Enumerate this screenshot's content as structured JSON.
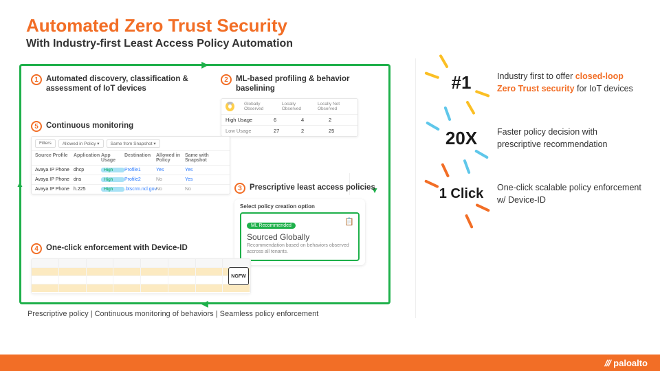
{
  "header": {
    "title": "Automated Zero Trust Security",
    "subtitle": "With Industry-first Least Access Policy Automation"
  },
  "steps": {
    "s1": {
      "num": "1",
      "title": "Automated discovery, classification & assessment of IoT devices"
    },
    "s2": {
      "num": "2",
      "title": "ML-based profiling & behavior baselining"
    },
    "s3": {
      "num": "3",
      "title": "Prescriptive least access policies"
    },
    "s4": {
      "num": "4",
      "title": "One-click enforcement with Device-ID"
    },
    "s5": {
      "num": "5",
      "title": "Continuous monitoring"
    }
  },
  "toolbar": {
    "filters": "Filters",
    "allowed": "Allowed in Policy ▾",
    "same": "Same from Snapshot ▾"
  },
  "table": {
    "headers": [
      "Source Profile",
      "Application",
      "App Usage",
      "Destination",
      "Allowed in Policy",
      "Same with Snapshot"
    ],
    "rows": [
      {
        "src": "Avaya IP Phone",
        "app": "dhcp",
        "usage": "High",
        "dest": "Profile1",
        "allowed": "Yes",
        "same": "Yes"
      },
      {
        "src": "Avaya IP Phone",
        "app": "dns",
        "usage": "High",
        "dest": "Profile2",
        "allowed": "No",
        "same": "Yes"
      },
      {
        "src": "Avaya IP Phone",
        "app": "h.225",
        "usage": "High",
        "dest": ".btscrm.ncl.gov",
        "allowed": "No",
        "same": "No"
      }
    ]
  },
  "ml": {
    "cols": [
      "Globally Observed",
      "Locally Observed",
      "Locally Not Observed"
    ],
    "rows": [
      {
        "label": "High Usage",
        "a": "6",
        "b": "4",
        "c": "2"
      },
      {
        "label": "Low Usage",
        "a": "27",
        "b": "2",
        "c": "25"
      }
    ]
  },
  "policy": {
    "caption": "Select policy creation option",
    "pill": "ML Recommended",
    "title": "Sourced Globally",
    "sub": "Recommendation based on behaviors observed accross all tenants."
  },
  "ngfw": "NGFW",
  "caption_bottom": "Prescriptive policy | Continuous monitoring of behaviors | Seamless policy enforcement",
  "stats": [
    {
      "big": "#1",
      "pre": "Industry first to offer ",
      "hl": "closed-loop Zero Trust security",
      "post": " for IoT devices"
    },
    {
      "big": "20X",
      "pre": "Faster policy decision with prescriptive recommendation",
      "hl": "",
      "post": ""
    },
    {
      "big": "1 Click",
      "pre": "One-click scalable policy enforcement w/ Device-ID",
      "hl": "",
      "post": ""
    }
  ],
  "footer": {
    "brand": "paloalto"
  }
}
